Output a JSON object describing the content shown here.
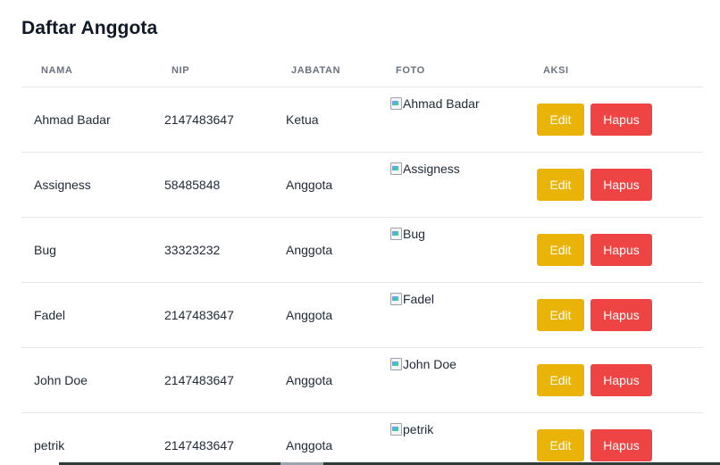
{
  "page": {
    "title": "Daftar Anggota"
  },
  "table": {
    "headers": [
      "NAMA",
      "NIP",
      "JABATAN",
      "FOTO",
      "AKSI"
    ],
    "rows": [
      {
        "nama": "Ahmad Badar",
        "nip": "2147483647",
        "jabatan": "Ketua",
        "foto_alt": "Ahmad Badar"
      },
      {
        "nama": "Assigness",
        "nip": "58485848",
        "jabatan": "Anggota",
        "foto_alt": "Assigness"
      },
      {
        "nama": "Bug",
        "nip": "33323232",
        "jabatan": "Anggota",
        "foto_alt": "Bug"
      },
      {
        "nama": "Fadel",
        "nip": "2147483647",
        "jabatan": "Anggota",
        "foto_alt": "Fadel"
      },
      {
        "nama": "John Doe",
        "nip": "2147483647",
        "jabatan": "Anggota",
        "foto_alt": "John Doe"
      },
      {
        "nama": "petrik",
        "nip": "2147483647",
        "jabatan": "Anggota",
        "foto_alt": "petrik"
      }
    ]
  },
  "actions": {
    "edit_label": "Edit",
    "delete_label": "Hapus"
  },
  "colors": {
    "edit": "#eab308",
    "delete": "#ef4444"
  },
  "icons": {
    "foto": "broken-image-icon"
  }
}
